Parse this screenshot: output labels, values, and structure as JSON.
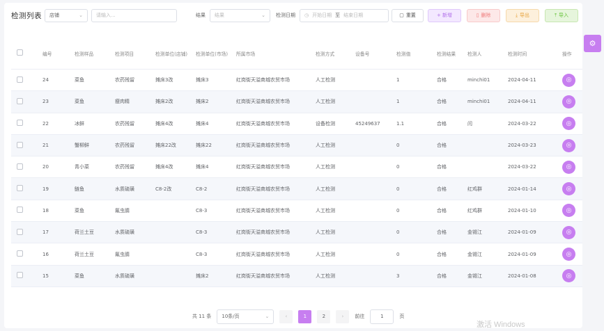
{
  "toolbar": {
    "title": "检测列表",
    "filter_select": "店铺",
    "search_placeholder": "请输入...",
    "result_label": "结果",
    "result_select_placeholder": "结果",
    "date_label": "检测日期",
    "date_start_placeholder": "开始日期",
    "date_sep": "至",
    "date_end_placeholder": "结束日期",
    "reset_label": "重置",
    "add_label": "+ 新增",
    "delete_label": "删除",
    "export_label": "导出",
    "import_label": "导入"
  },
  "table": {
    "headers": [
      "编号",
      "检测样品",
      "检测项目",
      "检测单位(店铺)",
      "检测单位(市场)",
      "所属市场",
      "检测方式",
      "设备号",
      "检测值",
      "检测结果",
      "检测人",
      "检测时间",
      "操作"
    ],
    "rows": [
      {
        "id": "24",
        "sample": "菜鱼",
        "item": "农药残留",
        "unit_shop": "摊床3改",
        "unit_market": "摊床3",
        "market": "红岗街天溢商城农贸市场",
        "method": "人工检测",
        "device": "",
        "value": "1",
        "result": "合格",
        "inspector": "minchi01",
        "time": "2024-04-11"
      },
      {
        "id": "23",
        "sample": "菜鱼",
        "item": "瘦肉精",
        "unit_shop": "摊床2改",
        "unit_market": "摊床2",
        "market": "红岗街天溢商城农贸市场",
        "method": "人工检测",
        "device": "",
        "value": "1",
        "result": "合格",
        "inspector": "minchi01",
        "time": "2024-04-11"
      },
      {
        "id": "22",
        "sample": "冰鲜",
        "item": "农药残留",
        "unit_shop": "摊床4改",
        "unit_market": "摊床4",
        "market": "红岗街天溢商城农贸市场",
        "method": "设备检测",
        "device": "45249637",
        "value": "1.1",
        "result": "合格",
        "inspector": "闫",
        "time": "2024-03-22"
      },
      {
        "id": "21",
        "sample": "蟹柳鲜",
        "item": "农药残留",
        "unit_shop": "摊床22改",
        "unit_market": "摊床22",
        "market": "红岗街天溢商城农贸市场",
        "method": "人工检测",
        "device": "",
        "value": "0",
        "result": "合格",
        "inspector": "",
        "time": "2024-03-23"
      },
      {
        "id": "20",
        "sample": "青小菜",
        "item": "农药残留",
        "unit_shop": "摊床4改",
        "unit_market": "摊床4",
        "market": "红岗街天溢商城农贸市场",
        "method": "人工检测",
        "device": "",
        "value": "0",
        "result": "合格",
        "inspector": "",
        "time": "2024-03-22"
      },
      {
        "id": "19",
        "sample": "鲢鱼",
        "item": "水质硫磺",
        "unit_shop": "C8-2改",
        "unit_market": "C8-2",
        "market": "红岗街天溢商城农贸市场",
        "method": "人工检测",
        "device": "",
        "value": "0",
        "result": "合格",
        "inspector": "红鸡群",
        "time": "2024-01-14"
      },
      {
        "id": "18",
        "sample": "菜鱼",
        "item": "氟虫腈",
        "unit_shop": "",
        "unit_market": "C8-3",
        "market": "红岗街天溢商城农贸市场",
        "method": "人工检测",
        "device": "",
        "value": "0",
        "result": "合格",
        "inspector": "红鸡群",
        "time": "2024-01-10"
      },
      {
        "id": "17",
        "sample": "荷兰土豆",
        "item": "水质硫磺",
        "unit_shop": "",
        "unit_market": "C8-3",
        "market": "红岗街天溢商城农贸市场",
        "method": "人工检测",
        "device": "",
        "value": "0",
        "result": "合格",
        "inspector": "金锡江",
        "time": "2024-01-09"
      },
      {
        "id": "16",
        "sample": "荷兰土豆",
        "item": "氟虫腈",
        "unit_shop": "",
        "unit_market": "C8-3",
        "market": "红岗街天溢商城农贸市场",
        "method": "人工检测",
        "device": "",
        "value": "0",
        "result": "合格",
        "inspector": "金锡江",
        "time": "2024-01-09"
      },
      {
        "id": "15",
        "sample": "菜鱼",
        "item": "水质硫磺",
        "unit_shop": "",
        "unit_market": "摊床2",
        "market": "红岗街天溢商城农贸市场",
        "method": "人工检测",
        "device": "",
        "value": "3",
        "result": "合格",
        "inspector": "金锡江",
        "time": "2024-01-08"
      }
    ]
  },
  "pagination": {
    "total_text": "共 11 条",
    "page_size": "10条/页",
    "pages": [
      "1",
      "2"
    ],
    "current_page": "1",
    "goto_label": "前往",
    "goto_value": "1",
    "page_suffix": "页"
  },
  "watermark": "激活 Windows",
  "colors": {
    "accent": "#c77ef0"
  }
}
